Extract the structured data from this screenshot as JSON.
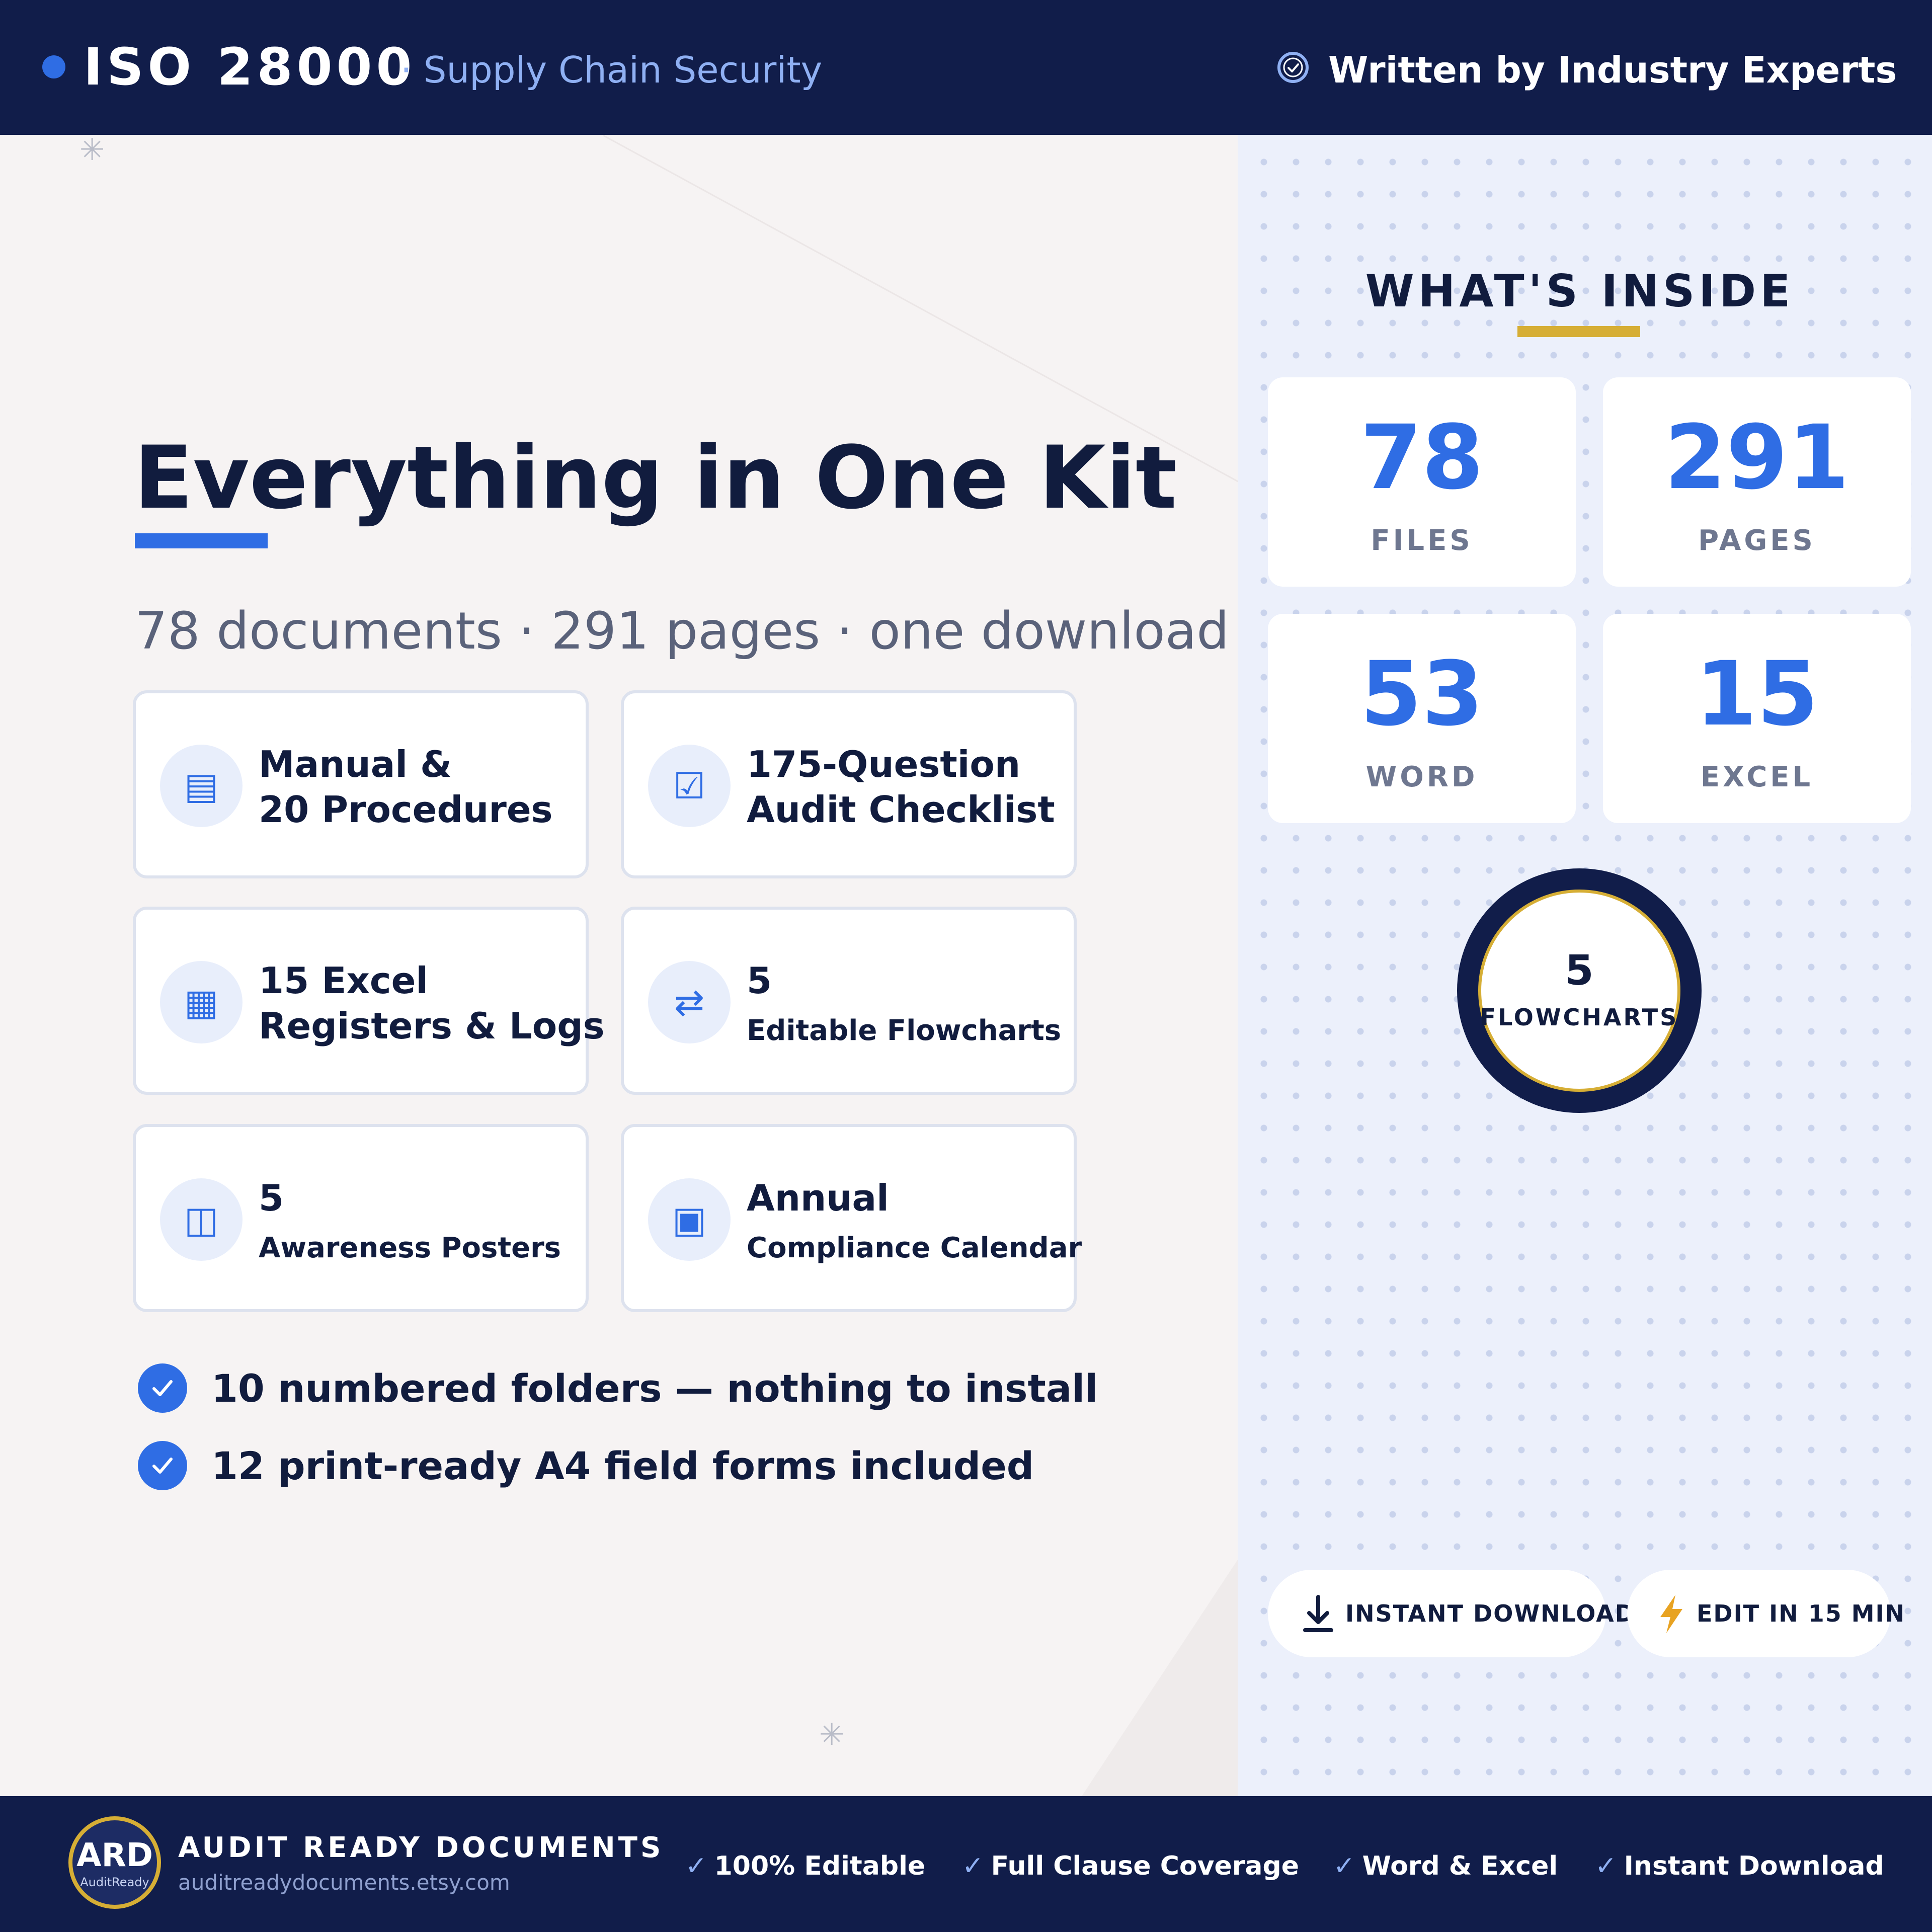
{
  "header": {
    "title": "ISO 28000",
    "subtitle": "· Supply Chain Security",
    "badge_text": "Written by Industry Experts",
    "badge_icon": "verified-check-icon"
  },
  "main": {
    "title": "Everything in One Kit",
    "subtitle": "78 documents · 291 pages · one download",
    "features": [
      {
        "icon": "document-icon",
        "glyph": "▤",
        "line1": "Manual &",
        "line2": "20 Procedures"
      },
      {
        "icon": "checklist-icon",
        "glyph": "☑",
        "line1": "175-Question",
        "line2": "Audit Checklist"
      },
      {
        "icon": "spreadsheet-icon",
        "glyph": "▦",
        "line1": "15 Excel",
        "line2": "Registers & Logs"
      },
      {
        "icon": "flow-arrows-icon",
        "glyph": "⇄",
        "line1": "5",
        "line2": "Editable Flowcharts"
      },
      {
        "icon": "poster-icon",
        "glyph": "◫",
        "line1": "5",
        "line2": "Awareness Posters"
      },
      {
        "icon": "calendar-icon",
        "glyph": "▣",
        "line1": "Annual",
        "line2": "Compliance Calendar"
      }
    ],
    "checks": [
      "10 numbered folders — nothing to install",
      "12 print-ready A4 field forms included"
    ]
  },
  "inside": {
    "title": "WHAT'S INSIDE",
    "stats": [
      {
        "value": "78",
        "label": "FILES"
      },
      {
        "value": "291",
        "label": "PAGES"
      },
      {
        "value": "53",
        "label": "WORD"
      },
      {
        "value": "15",
        "label": "EXCEL"
      }
    ],
    "badge": {
      "value": "5",
      "label": "FLOWCHARTS"
    },
    "pills": [
      {
        "icon": "download-icon",
        "label": "INSTANT DOWNLOAD"
      },
      {
        "icon": "lightning-icon",
        "label": "EDIT IN 15 MIN"
      }
    ]
  },
  "footer": {
    "logo_text": "ARD",
    "logo_subtext": "AuditReady",
    "brand": "AUDIT READY DOCUMENTS",
    "url": "auditreadydocuments.etsy.com",
    "features": [
      "100% Editable",
      "Full Clause Coverage",
      "Word & Excel",
      "Instant Download"
    ]
  },
  "colors": {
    "navy": "#111d4a",
    "accent_blue": "#2f6de4",
    "gold": "#d6ae35",
    "panel": "#ecf0fb"
  }
}
